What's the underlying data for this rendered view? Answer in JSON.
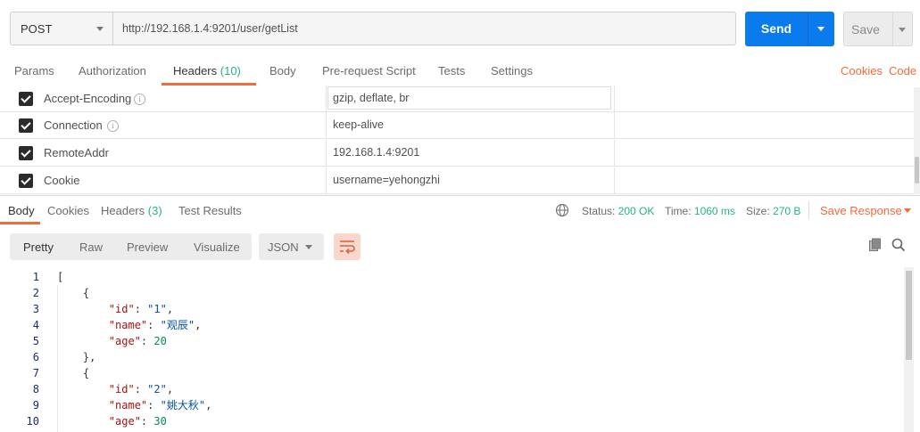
{
  "request": {
    "method": "POST",
    "url": "http://192.168.1.4:9201/user/getList",
    "send_label": "Send",
    "save_label": "Save"
  },
  "request_tabs": {
    "params": "Params",
    "authorization": "Authorization",
    "headers": "Headers",
    "headers_count": "(10)",
    "body": "Body",
    "prerequest": "Pre-request Script",
    "tests": "Tests",
    "settings": "Settings",
    "cookies": "Cookies",
    "code": "Code"
  },
  "headers": [
    {
      "key": "Accept-Encoding",
      "value": "gzip, deflate, br",
      "checked": true,
      "info": true
    },
    {
      "key": "Connection",
      "value": "keep-alive",
      "checked": true,
      "info": true
    },
    {
      "key": "RemoteAddr",
      "value": "192.168.1.4:9201",
      "checked": true,
      "info": false
    },
    {
      "key": "Cookie",
      "value": "username=yehongzhi",
      "checked": true,
      "info": false
    }
  ],
  "info_glyph": "i",
  "response_tabs": {
    "body": "Body",
    "cookies": "Cookies",
    "headers": "Headers",
    "headers_count": "(3)",
    "test_results": "Test Results"
  },
  "response_meta": {
    "status_label": "Status:",
    "status_value": "200 OK",
    "time_label": "Time:",
    "time_value": "1060 ms",
    "size_label": "Size:",
    "size_value": "270 B",
    "save_response": "Save Response"
  },
  "view_toolbar": {
    "pretty": "Pretty",
    "raw": "Raw",
    "preview": "Preview",
    "visualize": "Visualize",
    "format": "JSON"
  },
  "code_lines": [
    "[",
    "    {",
    "        \"id\": \"1\",",
    "        \"name\": \"观辰\",",
    "        \"age\": 20",
    "    },",
    "    {",
    "        \"id\": \"2\",",
    "        \"name\": \"姚大秋\",",
    "        \"age\": 30"
  ],
  "line_numbers": [
    "1",
    "2",
    "3",
    "4",
    "5",
    "6",
    "7",
    "8",
    "9",
    "10"
  ],
  "colors": {
    "accent": "#f26b3a",
    "send": "#097bed",
    "success": "#26b47f"
  }
}
